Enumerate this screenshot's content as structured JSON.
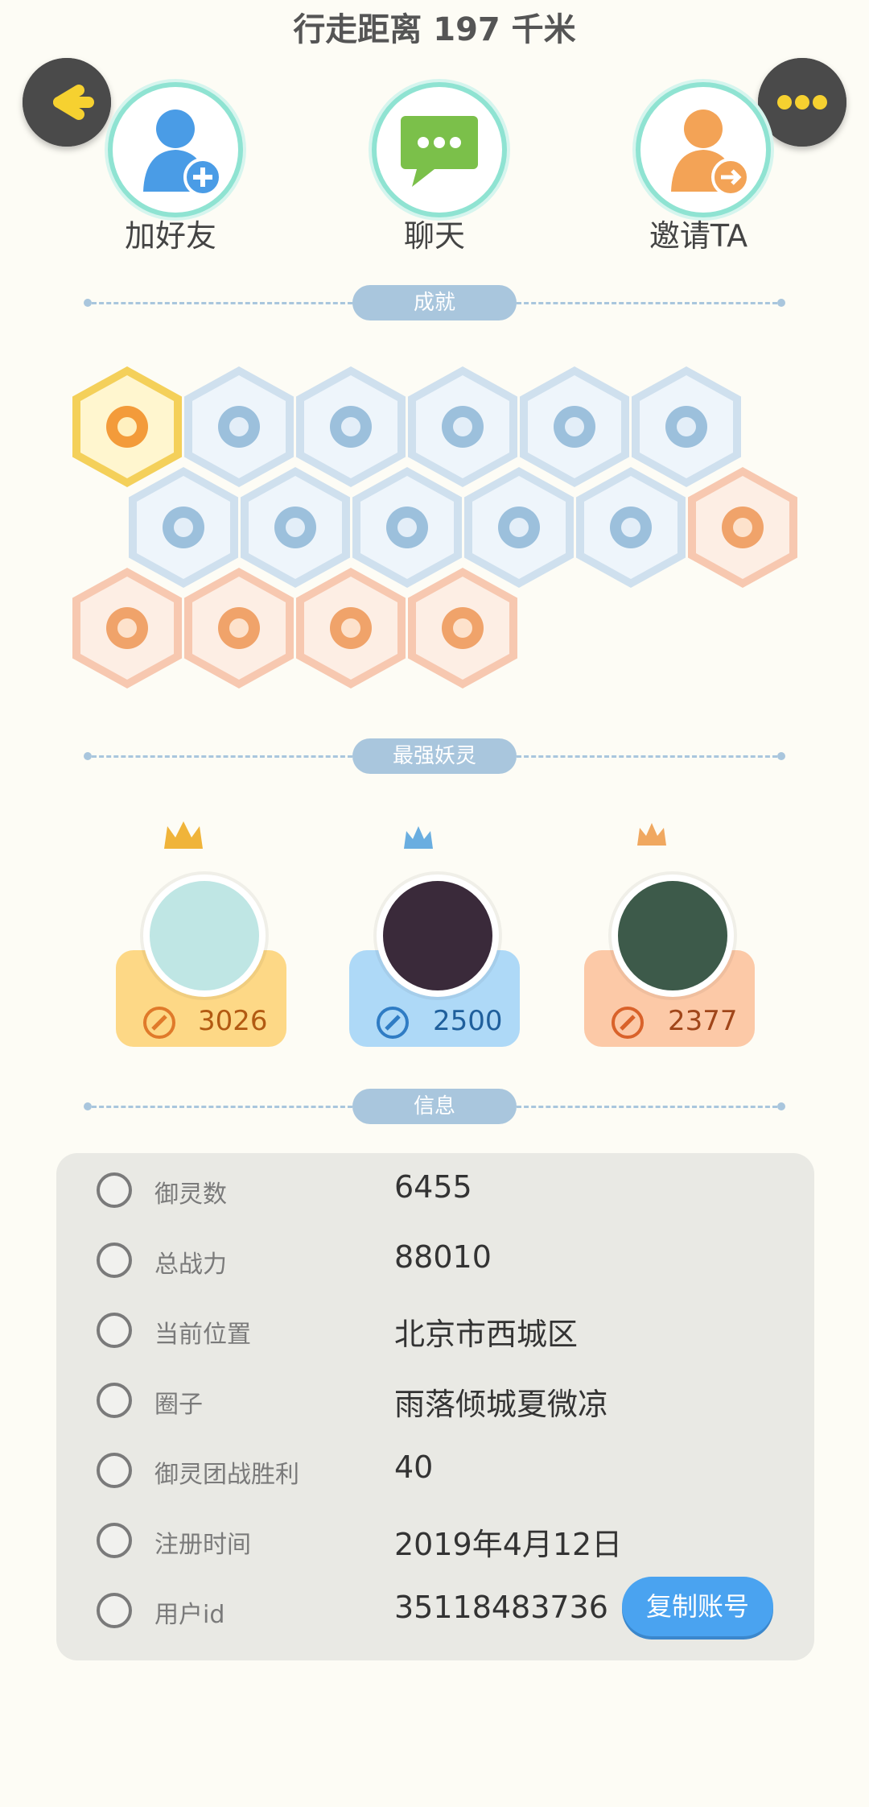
{
  "header": {
    "distance_title": "行走距离 197 千米"
  },
  "actions": [
    {
      "label": "加好友",
      "icon": "add-friend-icon"
    },
    {
      "label": "聊天",
      "icon": "chat-icon"
    },
    {
      "label": "邀请TA",
      "icon": "invite-icon"
    }
  ],
  "sections": {
    "achievements": "成就",
    "strongest": "最强妖灵",
    "info": "信息"
  },
  "achievements": {
    "row1": [
      "gold",
      "blue",
      "blue",
      "blue",
      "blue",
      "blue"
    ],
    "row2": [
      "blue",
      "blue",
      "blue",
      "blue",
      "blue",
      "orange"
    ],
    "row3": [
      "orange",
      "orange",
      "orange",
      "orange"
    ]
  },
  "strongest": [
    {
      "power": "3026",
      "card_color": "#fdd886",
      "crown_color": "#f0b43a"
    },
    {
      "power": "2500",
      "card_color": "#aed9f7",
      "crown_color": "#6aaee0"
    },
    {
      "power": "2377",
      "card_color": "#fcc9a7",
      "crown_color": "#f0a860"
    }
  ],
  "info": [
    {
      "icon": "yuling-icon",
      "label": "御灵数",
      "value": "6455"
    },
    {
      "icon": "power-icon",
      "label": "总战力",
      "value": "88010"
    },
    {
      "icon": "location-icon",
      "label": "当前位置",
      "value": "北京市西城区"
    },
    {
      "icon": "circle-icon",
      "label": "圈子",
      "value": "雨落倾城夏微凉"
    },
    {
      "icon": "team-battle-icon",
      "label": "御灵团战胜利",
      "value": "40"
    },
    {
      "icon": "clock-icon",
      "label": "注册时间",
      "value": "2019年4月12日"
    },
    {
      "icon": "user-id-icon",
      "label": "用户id",
      "value": "35118483736"
    }
  ],
  "copy_button": "复制账号",
  "colors": {
    "accent": "#4aa3f0",
    "section": "#a9c6dd",
    "background": "#fdfcf5"
  }
}
